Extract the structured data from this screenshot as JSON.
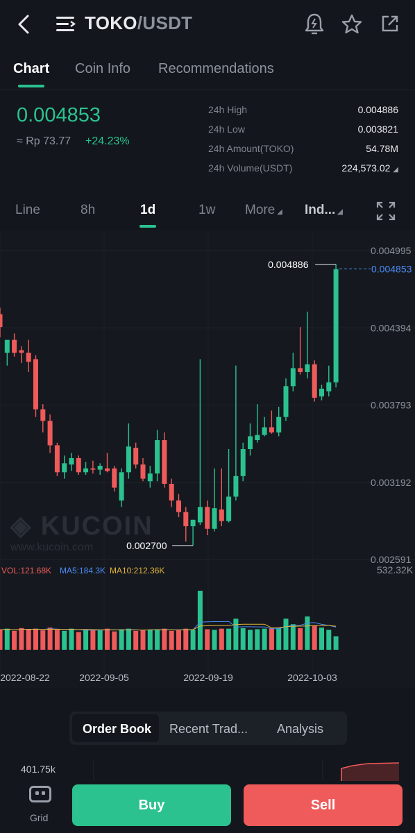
{
  "header": {
    "base": "TOKO",
    "quote": "/USDT",
    "back_icon": "chevron-left-icon",
    "menu_icon": "menu-icon",
    "alert_icon": "bell-alert-icon",
    "favorite_icon": "star-icon",
    "share_icon": "share-icon"
  },
  "tabs": [
    {
      "label": "Chart",
      "active": true
    },
    {
      "label": "Coin Info",
      "active": false
    },
    {
      "label": "Recommendations",
      "active": false
    }
  ],
  "ticker": {
    "price": "0.004853",
    "fiat": "≈ Rp 73.77",
    "change": "+24.23%",
    "stats": [
      {
        "label": "24h High",
        "value": "0.004886"
      },
      {
        "label": "24h Low",
        "value": "0.003821"
      },
      {
        "label": "24h Amount(TOKO)",
        "value": "54.78M"
      },
      {
        "label": "24h Volume(USDT)",
        "value": "224,573.02"
      }
    ]
  },
  "intervals": [
    {
      "label": "Line",
      "active": false
    },
    {
      "label": "8h",
      "active": false
    },
    {
      "label": "1d",
      "active": true
    },
    {
      "label": "1w",
      "active": false
    },
    {
      "label": "More",
      "active": false
    },
    {
      "label": "Ind...",
      "active": false
    }
  ],
  "fullscreen_icon": "expand-icon",
  "watermark": {
    "brand": "KUCOIN",
    "url": "www.kucoin.com"
  },
  "colors": {
    "up": "#2bc28f",
    "down": "#ef5a5a",
    "ma5": "#4c8bf5",
    "ma10": "#e3b23c"
  },
  "chart_data": {
    "type": "candlestick",
    "price_axis": [
      "0.004995",
      "0.004394",
      "0.003793",
      "0.003192",
      "0.002591"
    ],
    "ylim": [
      0.002591,
      0.004995
    ],
    "last_price": "0.004853",
    "high_marker": "0.004886",
    "low_marker": "0.002700",
    "x_ticks": [
      "2022-08-22",
      "2022-09-05",
      "2022-09-19",
      "2022-10-03"
    ],
    "volume_legend": {
      "vol": "VOL:121.68K",
      "ma5": "MA5:184.3K",
      "ma10": "MA10:212.36K"
    },
    "volume_axis_max": "532.32K",
    "volume_max": 532320,
    "candles": [
      {
        "o": 0.0045,
        "h": 0.00455,
        "l": 0.00432,
        "c": 0.0044
      },
      {
        "o": 0.0042,
        "h": 0.0043,
        "l": 0.0041,
        "c": 0.0043
      },
      {
        "o": 0.0043,
        "h": 0.00435,
        "l": 0.00417,
        "c": 0.0042
      },
      {
        "o": 0.00422,
        "h": 0.00425,
        "l": 0.00412,
        "c": 0.0042
      },
      {
        "o": 0.0042,
        "h": 0.0043,
        "l": 0.00405,
        "c": 0.00413
      },
      {
        "o": 0.00415,
        "h": 0.00418,
        "l": 0.0037,
        "c": 0.00376
      },
      {
        "o": 0.00376,
        "h": 0.0038,
        "l": 0.00358,
        "c": 0.00367
      },
      {
        "o": 0.00367,
        "h": 0.00372,
        "l": 0.00342,
        "c": 0.00348
      },
      {
        "o": 0.00348,
        "h": 0.0035,
        "l": 0.00324,
        "c": 0.00327
      },
      {
        "o": 0.00327,
        "h": 0.0034,
        "l": 0.00322,
        "c": 0.00334
      },
      {
        "o": 0.00333,
        "h": 0.00342,
        "l": 0.00328,
        "c": 0.00338
      },
      {
        "o": 0.00338,
        "h": 0.0034,
        "l": 0.00325,
        "c": 0.00327
      },
      {
        "o": 0.00327,
        "h": 0.00335,
        "l": 0.00325,
        "c": 0.0033
      },
      {
        "o": 0.0033,
        "h": 0.00336,
        "l": 0.00326,
        "c": 0.00329
      },
      {
        "o": 0.00329,
        "h": 0.00334,
        "l": 0.00325,
        "c": 0.00332
      },
      {
        "o": 0.0033,
        "h": 0.00342,
        "l": 0.00327,
        "c": 0.00328
      },
      {
        "o": 0.0033,
        "h": 0.00332,
        "l": 0.00312,
        "c": 0.00315
      },
      {
        "o": 0.00305,
        "h": 0.0033,
        "l": 0.003,
        "c": 0.00327
      },
      {
        "o": 0.00327,
        "h": 0.00365,
        "l": 0.00322,
        "c": 0.00347
      },
      {
        "o": 0.00346,
        "h": 0.0035,
        "l": 0.0033,
        "c": 0.00333
      },
      {
        "o": 0.00333,
        "h": 0.00338,
        "l": 0.0032,
        "c": 0.00322
      },
      {
        "o": 0.0032,
        "h": 0.00332,
        "l": 0.00315,
        "c": 0.00326
      },
      {
        "o": 0.00326,
        "h": 0.0036,
        "l": 0.0032,
        "c": 0.00352
      },
      {
        "o": 0.00352,
        "h": 0.00358,
        "l": 0.00315,
        "c": 0.00318
      },
      {
        "o": 0.00318,
        "h": 0.00322,
        "l": 0.003,
        "c": 0.00305
      },
      {
        "o": 0.00305,
        "h": 0.0031,
        "l": 0.00292,
        "c": 0.00296
      },
      {
        "o": 0.00296,
        "h": 0.003,
        "l": 0.00273,
        "c": 0.00285
      },
      {
        "o": 0.00285,
        "h": 0.0029,
        "l": 0.0027,
        "c": 0.0029
      },
      {
        "o": 0.00288,
        "h": 0.00415,
        "l": 0.00286,
        "c": 0.003
      },
      {
        "o": 0.003,
        "h": 0.00305,
        "l": 0.00278,
        "c": 0.00283
      },
      {
        "o": 0.00283,
        "h": 0.0033,
        "l": 0.00281,
        "c": 0.00299
      },
      {
        "o": 0.00298,
        "h": 0.0033,
        "l": 0.00285,
        "c": 0.00289
      },
      {
        "o": 0.00289,
        "h": 0.00345,
        "l": 0.00288,
        "c": 0.00308
      },
      {
        "o": 0.00308,
        "h": 0.0041,
        "l": 0.00305,
        "c": 0.00324
      },
      {
        "o": 0.00324,
        "h": 0.0035,
        "l": 0.0032,
        "c": 0.00345
      },
      {
        "o": 0.00345,
        "h": 0.00365,
        "l": 0.0034,
        "c": 0.00355
      },
      {
        "o": 0.00352,
        "h": 0.0038,
        "l": 0.0035,
        "c": 0.00356
      },
      {
        "o": 0.00356,
        "h": 0.0037,
        "l": 0.00355,
        "c": 0.00362
      },
      {
        "o": 0.00362,
        "h": 0.00375,
        "l": 0.00357,
        "c": 0.00358
      },
      {
        "o": 0.00358,
        "h": 0.00378,
        "l": 0.00355,
        "c": 0.0037
      },
      {
        "o": 0.0037,
        "h": 0.004,
        "l": 0.00367,
        "c": 0.00394
      },
      {
        "o": 0.00394,
        "h": 0.0042,
        "l": 0.0039,
        "c": 0.00408
      },
      {
        "o": 0.00408,
        "h": 0.0044,
        "l": 0.00403,
        "c": 0.00405
      },
      {
        "o": 0.00405,
        "h": 0.00452,
        "l": 0.004,
        "c": 0.00411
      },
      {
        "o": 0.00411,
        "h": 0.00414,
        "l": 0.00382,
        "c": 0.00385
      },
      {
        "o": 0.00386,
        "h": 0.00395,
        "l": 0.00383,
        "c": 0.00392
      },
      {
        "o": 0.0039,
        "h": 0.0041,
        "l": 0.00386,
        "c": 0.00397
      },
      {
        "o": 0.00397,
        "h": 0.00489,
        "l": 0.00393,
        "c": 0.00485
      }
    ],
    "volumes": [
      180000,
      190000,
      170000,
      195000,
      185000,
      190000,
      175000,
      200000,
      180000,
      170000,
      190000,
      160000,
      185000,
      180000,
      175000,
      190000,
      165000,
      185000,
      190000,
      170000,
      175000,
      180000,
      185000,
      190000,
      170000,
      175000,
      190000,
      180000,
      532320,
      185000,
      180000,
      190000,
      190000,
      280000,
      195000,
      180000,
      185000,
      190000,
      195000,
      200000,
      280000,
      230000,
      195000,
      300000,
      220000,
      200000,
      180000,
      121680
    ]
  },
  "segments": [
    {
      "label": "Order Book",
      "active": true
    },
    {
      "label": "Recent Trad...",
      "active": false
    },
    {
      "label": "Analysis",
      "active": false
    }
  ],
  "depth_label": "401.75k",
  "footer": {
    "grid_label": "Grid",
    "grid_icon": "grid-icon",
    "buy": "Buy",
    "sell": "Sell"
  }
}
